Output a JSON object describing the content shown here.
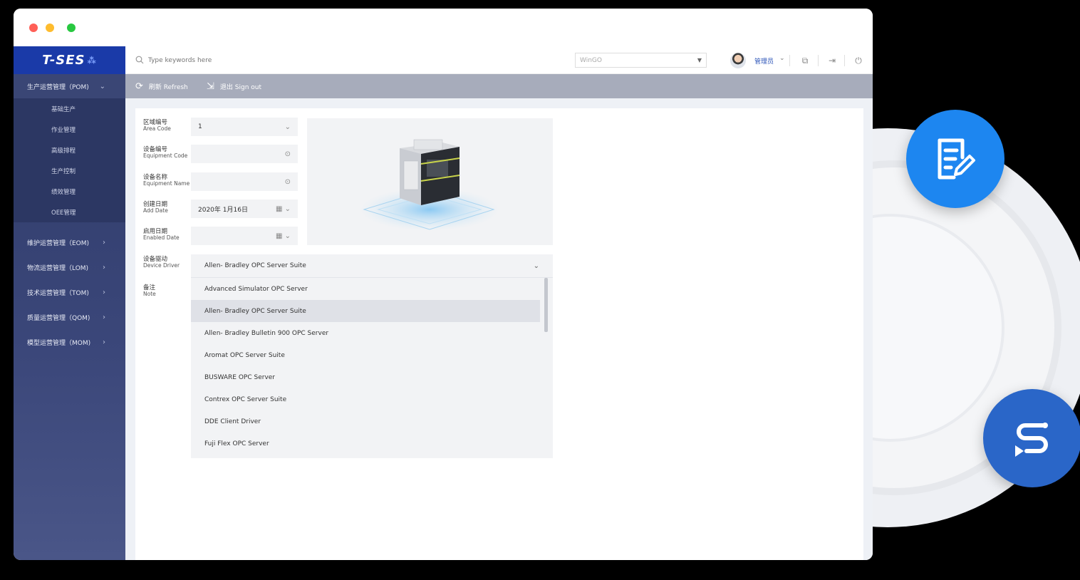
{
  "window": {
    "logo": "T-SES"
  },
  "sidebar": {
    "groups": [
      {
        "label": "生产运营管理（POM)",
        "expanded": true
      },
      {
        "label": "维护运营管理（EOM)",
        "expanded": false
      },
      {
        "label": "物流运营管理（LOM)",
        "expanded": false
      },
      {
        "label": "技术运营管理（TOM)",
        "expanded": false
      },
      {
        "label": "质量运营管理（QOM)",
        "expanded": false
      },
      {
        "label": "模型运营管理（MOM)",
        "expanded": false
      }
    ],
    "subitems": [
      "基础生产",
      "作业管理",
      "高级排程",
      "生产控制",
      "绩效管理",
      "OEE管理"
    ]
  },
  "topbar": {
    "search_placeholder": "Type keywords here",
    "site_select": "WinGO",
    "user_name": "管理员"
  },
  "toolbar": {
    "refresh_label": "刷新 Refresh",
    "signout_label": "退出 Sign out"
  },
  "form": {
    "area_code": {
      "zh": "区域编号",
      "en": "Area Code",
      "value": "1"
    },
    "equipment_code": {
      "zh": "设备编号",
      "en": "Equipment Code",
      "value": ""
    },
    "equipment_name": {
      "zh": "设备名称",
      "en": "Equipment Name",
      "value": ""
    },
    "add_date": {
      "zh": "创建日期",
      "en": "Add Date",
      "value": "2020年 1月16日"
    },
    "enabled_date": {
      "zh": "启用日期",
      "en": "Enabled Date",
      "value": ""
    },
    "device_driver": {
      "zh": "设备驱动",
      "en": "Device Driver",
      "value": "Allen- Bradley  OPC Server Suite"
    },
    "note": {
      "zh": "备注",
      "en": "Note"
    }
  },
  "driver_options": [
    "Advanced Simulator OPC Server",
    "Allen- Bradley  OPC Server Suite",
    "Allen- Bradley Bulletin 900 OPC Server",
    "Aromat OPC Server Suite",
    "BUSWARE OPC Server",
    "Contrex OPC Server Suite",
    "DDE Client Driver",
    "Fuji Flex OPC Server"
  ],
  "driver_selected_index": 1,
  "colors": {
    "logo_bg": "#1a3aa8",
    "sidebar_bg": "#2e3a68",
    "toolbar_bg": "#a7acbb",
    "badge_doc": "#1d86f0",
    "badge_s": "#2a66c8"
  }
}
